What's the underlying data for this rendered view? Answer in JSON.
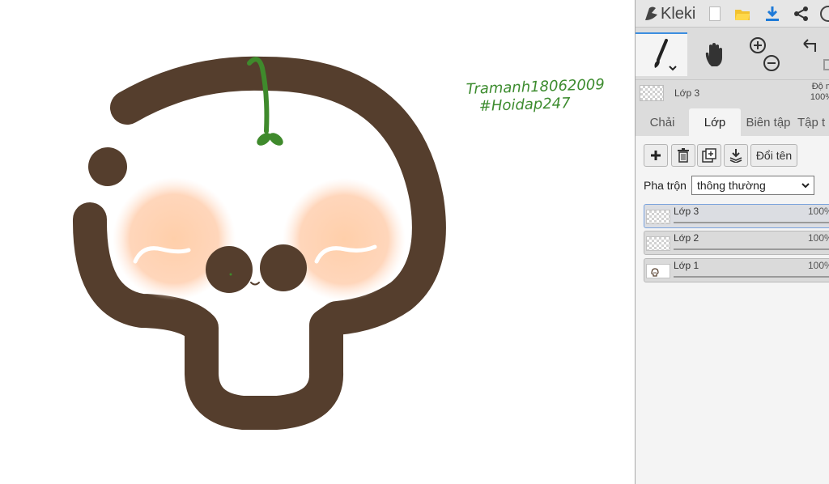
{
  "app": {
    "name": "Kleki"
  },
  "artwork": {
    "signature_line1": "Tramanh18062009",
    "signature_line2": "#Hoidap247"
  },
  "toolbar": {
    "icons": [
      "new-file-icon",
      "open-folder-icon",
      "download-icon",
      "share-icon",
      "help-icon"
    ]
  },
  "tools": {
    "brush": "brush-icon",
    "hand": "hand-icon",
    "zoom_in": "zoom-in-icon",
    "zoom_out": "zoom-out-icon",
    "undo": "undo-icon"
  },
  "current_layer": {
    "name": "Lớp 3",
    "opacity_label_line1": "Độ m",
    "opacity_label_line2": "100%"
  },
  "tabs": [
    {
      "label": "Chải"
    },
    {
      "label": "Lớp"
    },
    {
      "label": "Biên tập"
    },
    {
      "label": "Tập t"
    }
  ],
  "active_tab": "Lớp",
  "layer_buttons": {
    "rename_label": "Đổi tên"
  },
  "blend": {
    "label": "Pha trộn",
    "value": "thông thường"
  },
  "layers": [
    {
      "name": "Lớp 3",
      "opacity": "100%",
      "opacity_value": 100,
      "selected": true
    },
    {
      "name": "Lớp 2",
      "opacity": "100%",
      "opacity_value": 100,
      "selected": false
    },
    {
      "name": "Lớp 1",
      "opacity": "100%",
      "opacity_value": 100,
      "selected": false
    }
  ],
  "colors": {
    "accent": "#3c8ee0",
    "brown": "#553e2d",
    "blush": "#ffd3b5",
    "sprout_green": "#3f8a2c",
    "signature_green": "#3d8c2f"
  }
}
